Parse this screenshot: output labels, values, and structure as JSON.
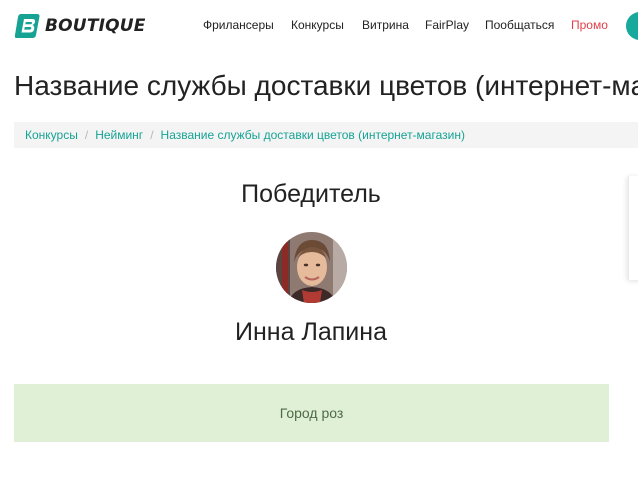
{
  "header": {
    "logo_text": "BOUTIQUE",
    "nav": [
      {
        "id": "freelancers",
        "label": "Фрилансеры"
      },
      {
        "id": "contests",
        "label": "Конкурсы"
      },
      {
        "id": "showcase",
        "label": "Витрина"
      },
      {
        "id": "fairplay",
        "label": "FairPlay"
      },
      {
        "id": "chat",
        "label": "Пообщаться"
      },
      {
        "id": "promo",
        "label": "Промо"
      }
    ]
  },
  "page": {
    "title": "Название службы доставки цветов (интернет-магазин)"
  },
  "breadcrumb": [
    {
      "label": "Конкурсы"
    },
    {
      "label": "Нейминг"
    },
    {
      "label": "Название службы доставки цветов (интернет-магазин)"
    }
  ],
  "winner": {
    "heading": "Победитель",
    "name": "Инна Лапина"
  },
  "result": {
    "text": "Город роз"
  },
  "colors": {
    "accent": "#16a394",
    "promo": "#e0414a",
    "result_bg": "#dff0d6",
    "breadcrumb_bg": "#f4f4f4"
  }
}
